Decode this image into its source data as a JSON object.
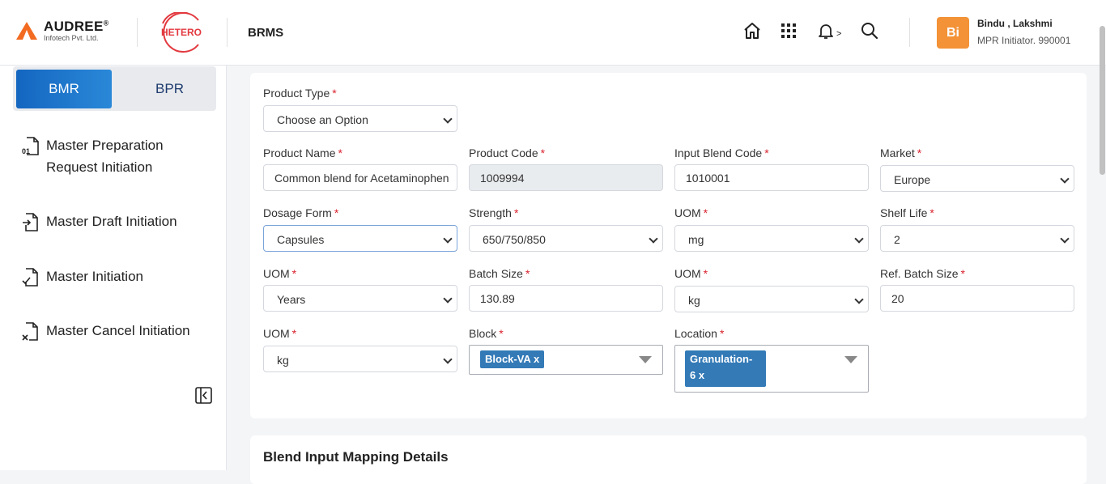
{
  "header": {
    "logo_name": "AUDREE",
    "logo_reg": "®",
    "logo_sub": "Infotech Pvt. Ltd.",
    "client_logo_text": "HETERO",
    "app_name": "BRMS",
    "notification_caret": ">",
    "avatar_initials": "Bi",
    "user_name": "Bindu , Lakshmi",
    "user_role": "MPR Initiator. 990001",
    "brand_orange": "#f26b21",
    "client_red": "#e2393f"
  },
  "sidebar": {
    "toggle": {
      "active": "BMR",
      "inactive": "BPR"
    },
    "items": [
      {
        "line1": "Master Preparation",
        "line2": "Request Initiation",
        "icon": "document-01-icon"
      },
      {
        "line1": "Master Draft Initiation",
        "icon": "document-arrow-icon"
      },
      {
        "line1": "Master Initiation",
        "icon": "document-check-icon"
      },
      {
        "line1": "Master Cancel Initiation",
        "icon": "document-x-icon"
      }
    ]
  },
  "form": {
    "required_mark": "*",
    "product_type": {
      "label": "Product Type",
      "value": "Choose an Option"
    },
    "product_name": {
      "label": "Product Name",
      "value": "Common blend for Acetaminophen"
    },
    "product_code": {
      "label": "Product Code",
      "value": "1009994"
    },
    "input_blend_code": {
      "label": "Input Blend Code",
      "value": "1010001"
    },
    "market": {
      "label": "Market",
      "value": "Europe"
    },
    "dosage_form": {
      "label": "Dosage Form",
      "value": "Capsules"
    },
    "strength": {
      "label": "Strength",
      "value": "650/750/850"
    },
    "uom_strength": {
      "label": "UOM",
      "value": "mg"
    },
    "shelf_life": {
      "label": "Shelf Life",
      "value": "2"
    },
    "uom_shelf": {
      "label": "UOM",
      "value": "Years"
    },
    "batch_size": {
      "label": "Batch Size",
      "value": "130.89"
    },
    "uom_batch": {
      "label": "UOM",
      "value": "kg"
    },
    "ref_batch_size": {
      "label": "Ref. Batch Size",
      "value": "20"
    },
    "uom_ref": {
      "label": "UOM",
      "value": "kg"
    },
    "block": {
      "label": "Block",
      "chip_line1": "Block-VA x"
    },
    "location": {
      "label": "Location",
      "chip_line1": "Granulation-",
      "chip_line2": "6 x"
    },
    "chip_color": "#337ab7"
  },
  "section2": {
    "title": "Blend Input Mapping Details"
  }
}
